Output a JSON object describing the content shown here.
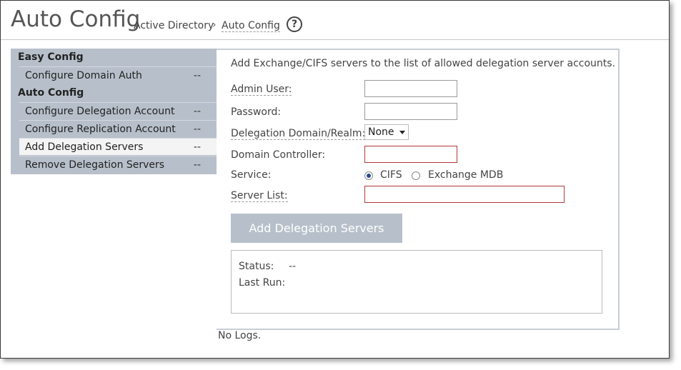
{
  "header": {
    "title": "Auto Config",
    "breadcrumb": [
      "Active Directory",
      "Auto Config"
    ],
    "separator": "›",
    "help_icon": "question-circle-icon"
  },
  "sidebar": {
    "groups": [
      {
        "label": "Easy Config",
        "items": [
          {
            "label": "Configure Domain Auth",
            "status": "--"
          }
        ]
      },
      {
        "label": "Auto Config",
        "items": [
          {
            "label": "Configure Delegation Account",
            "status": "--"
          },
          {
            "label": "Configure Replication Account",
            "status": "--"
          },
          {
            "label": "Add Delegation Servers",
            "status": "--",
            "active": true
          },
          {
            "label": "Remove Delegation Servers",
            "status": "--"
          }
        ]
      }
    ]
  },
  "form": {
    "description": "Add Exchange/CIFS servers to the list of allowed delegation server accounts.",
    "admin_user_label": "Admin User:",
    "admin_user_value": "",
    "password_label": "Password:",
    "password_value": "",
    "domain_label": "Delegation Domain/Realm:",
    "domain_selected": "None",
    "dc_label": "Domain Controller:",
    "dc_value": "",
    "service_label": "Service:",
    "service_options": [
      "CIFS",
      "Exchange MDB"
    ],
    "service_selected": "CIFS",
    "server_list_label": "Server List:",
    "server_list_value": "",
    "submit_label": "Add Delegation Servers"
  },
  "status": {
    "status_label": "Status:",
    "status_value": "--",
    "last_run_label": "Last Run:",
    "last_run_value": ""
  },
  "logs_text": "No Logs."
}
